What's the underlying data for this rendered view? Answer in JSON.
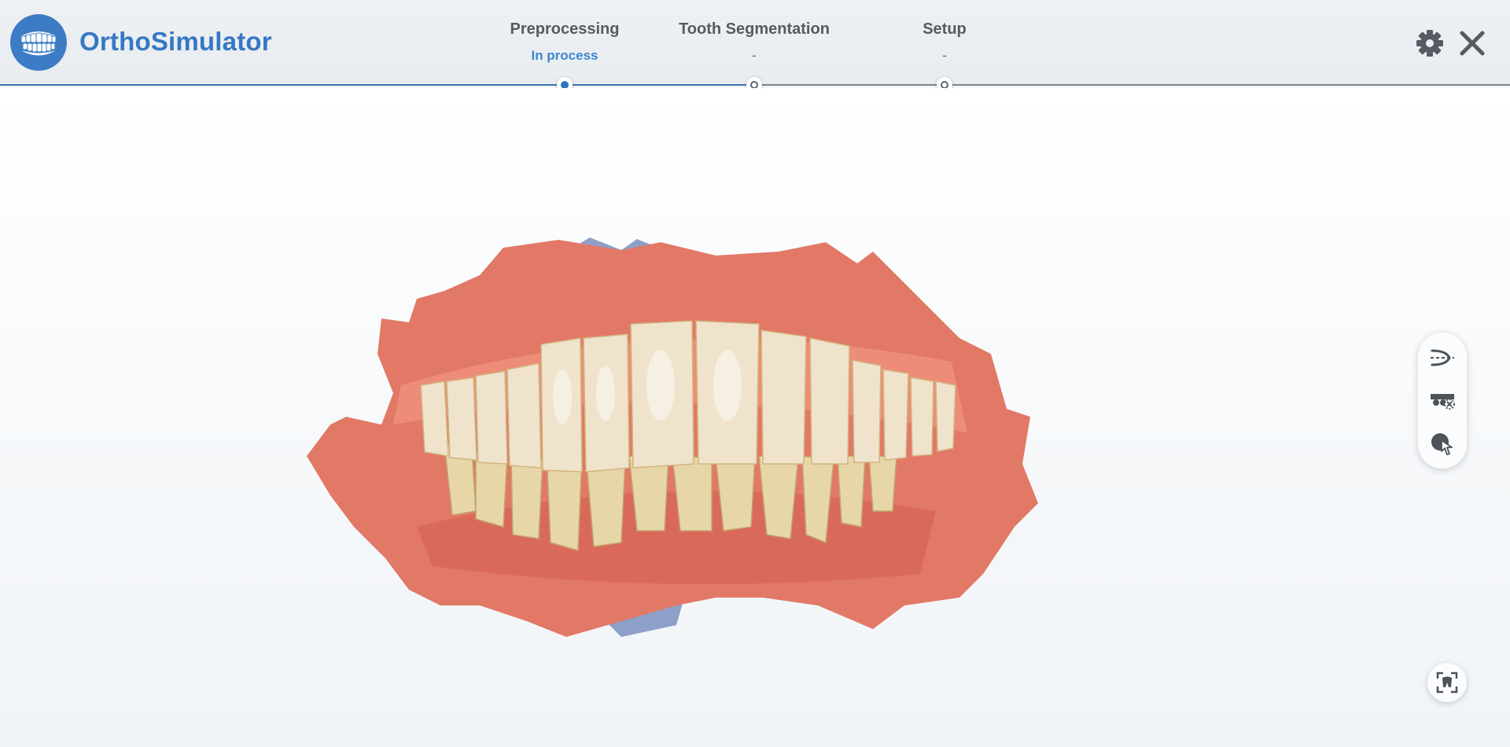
{
  "app": {
    "title": "OrthoSimulator"
  },
  "steps": [
    {
      "name": "Preprocessing",
      "status": "In process"
    },
    {
      "name": "Tooth Segmentation",
      "status": "-"
    },
    {
      "name": "Setup",
      "status": "-"
    }
  ],
  "header": {
    "icons": [
      "settings-icon",
      "close-icon"
    ]
  },
  "toolbar": {
    "icons": [
      "occlusal-plane-icon",
      "bracket-remove-icon",
      "tooth-select-icon"
    ]
  },
  "viewport": {
    "fit_icon": "fit-view-icon"
  },
  "colors": {
    "accent": "#3578c4",
    "track_active": "#3b73b4",
    "track_inactive": "#7d848c",
    "gum": "#e27866",
    "tooth": "#efe3cc"
  }
}
